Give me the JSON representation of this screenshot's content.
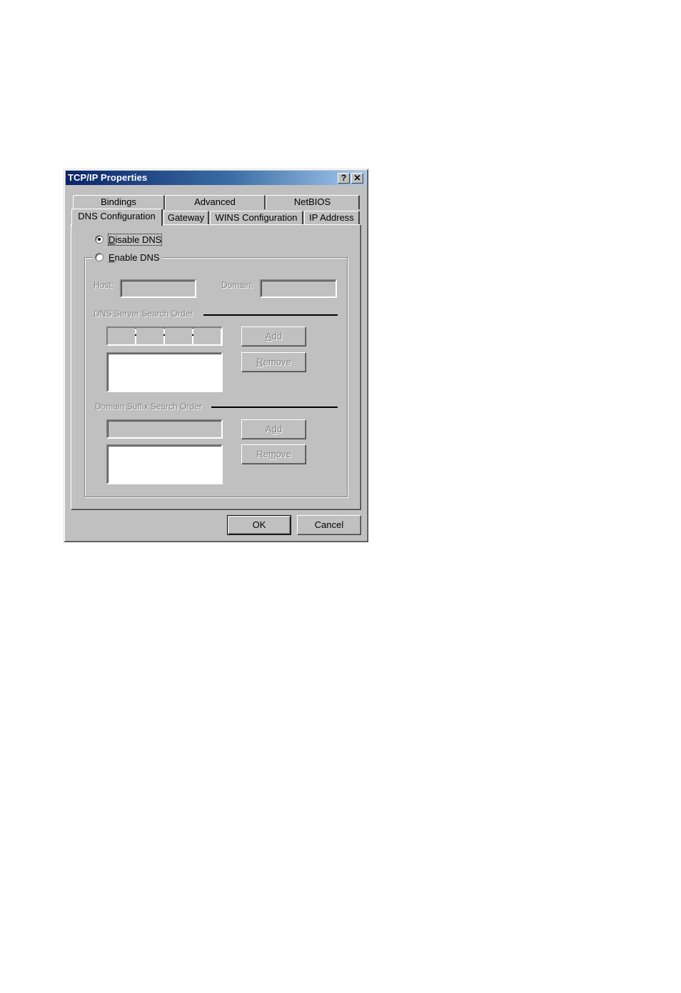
{
  "window": {
    "title": "TCP/IP Properties",
    "help_button": "?",
    "close_button": "✕"
  },
  "tabs": {
    "row_back": [
      {
        "label": "Bindings"
      },
      {
        "label": "Advanced"
      },
      {
        "label": "NetBIOS"
      }
    ],
    "row_front": [
      {
        "label": "DNS Configuration",
        "active": true
      },
      {
        "label": "Gateway"
      },
      {
        "label": "WINS Configuration"
      },
      {
        "label": "IP Address"
      }
    ]
  },
  "dns": {
    "disable_label": "Disable DNS",
    "enable_label": "Enable DNS",
    "selected": "disable",
    "host_label": "Host:",
    "host_value": "",
    "domain_label": "Domain:",
    "domain_value": "",
    "server_section": "DNS Server Search Order",
    "server_ip": [
      "",
      "",
      "",
      ""
    ],
    "server_list": [],
    "server_add": "Add",
    "server_remove": "Remove",
    "suffix_section": "Domain Suffix Search Order",
    "suffix_value": "",
    "suffix_list": [],
    "suffix_add": "Add",
    "suffix_remove": "Remove"
  },
  "footer": {
    "ok": "OK",
    "cancel": "Cancel"
  }
}
